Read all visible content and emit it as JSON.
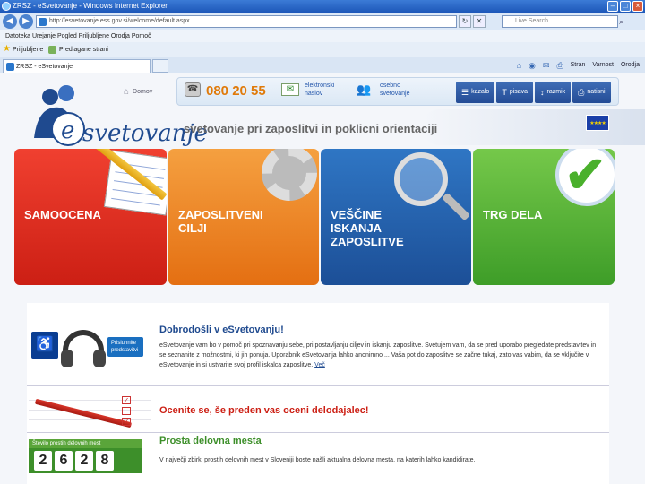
{
  "browser": {
    "title": "ZRSZ - eSvetovanje - Windows Internet Explorer",
    "address": "http://esvetovanje.ess.gov.si/welcome/default.aspx",
    "search_placeholder": "Live Search",
    "menu": "Datoteka  Urejanje  Pogled  Priljubljene  Orodja  Pomoč",
    "favorites_label": "Priljubljene",
    "favorites_item": "Predlagane strani",
    "tab_title": "ZRSZ - eSvetovanje",
    "tools": [
      "Stran",
      "Varnost",
      "Orodja"
    ]
  },
  "header": {
    "home_label": "Domov",
    "phone": "080 20 55",
    "email_text": [
      "elektronski",
      "naslov"
    ],
    "contact_text": [
      "osebno",
      "svetovanje"
    ],
    "buttons": [
      {
        "label": "kazalo",
        "icon": "list-icon"
      },
      {
        "label": "pisava",
        "icon": "text-size-icon"
      },
      {
        "label": "razmik",
        "icon": "spacing-icon"
      },
      {
        "label": "natisni",
        "icon": "print-icon"
      }
    ],
    "logo_text": "svetovanje",
    "tagline": "svetovanje pri zaposlitvi in poklicni orientaciji"
  },
  "tiles": [
    {
      "label": "SAMOOCENA",
      "color": "#e6321f"
    },
    {
      "label": "ZAPOSLITVENI\nCILJI",
      "color": "#ef8a1f"
    },
    {
      "label": "VEŠČINE\nISKANJA\nZAPOSLITVE",
      "color": "#2462ad"
    },
    {
      "label": "TRG DELA",
      "color": "#5cb33a"
    }
  ],
  "sections": {
    "welcome": {
      "title": "Dobrodošli v eSvetovanju!",
      "body": "eSvetovanje vam bo v pomoč pri spoznavanju sebe, pri postavljanju ciljev in iskanju zaposlitve. Svetujem vam, da se pred uporabo pregledate predstavitev in se seznanite z možnostmi, ki jih ponuja. Uporabnik eSvetovanja lahko anonimno ... Vaša pot do zaposlitve se začne tukaj, zato vas vabim, da se vključite v eSvetovanje in si ustvarite svoj profil iskalca zaposlitve.",
      "more_link": "Več",
      "listen_label": "Prisluhnite predstavitvi"
    },
    "assess": {
      "title": "Ocenite se, še preden vas oceni delodajalec!"
    },
    "jobs": {
      "title": "Prosta delovna mesta",
      "counter_label": "Število prostih delovnih mest",
      "digits": [
        "2",
        "6",
        "2",
        "8"
      ],
      "body": "V največji zbirki prostih delovnih mest v Sloveniji boste našli aktualna delovna mesta, na katerih lahko kandidirate."
    }
  }
}
